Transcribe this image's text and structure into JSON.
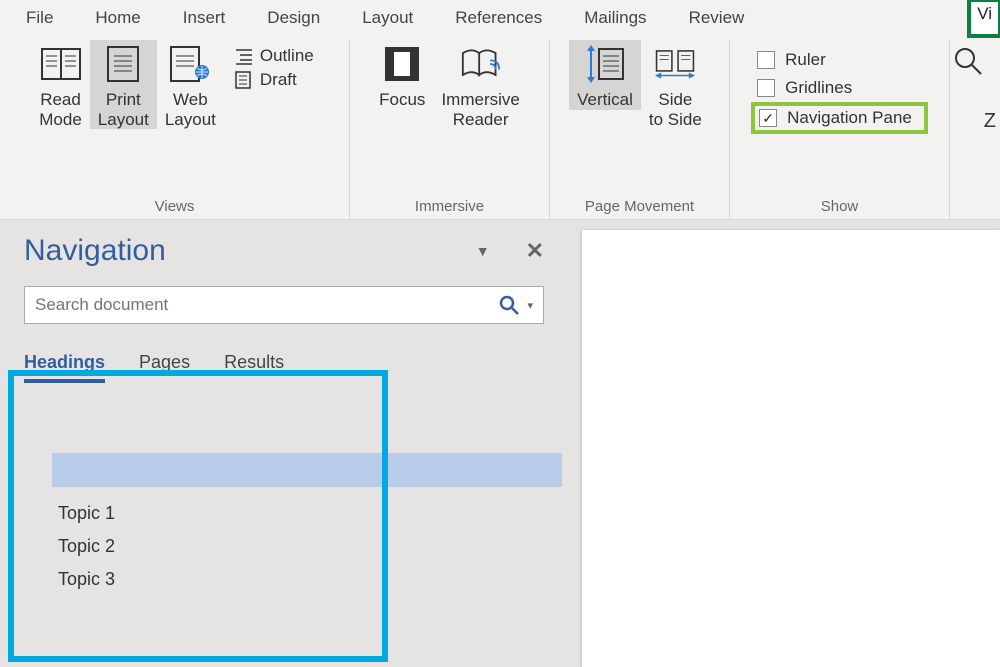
{
  "menu": {
    "file": "File",
    "home": "Home",
    "insert": "Insert",
    "design": "Design",
    "layout": "Layout",
    "references": "References",
    "mailings": "Mailings",
    "review": "Review",
    "view_partial": "Vi"
  },
  "ribbon": {
    "views": {
      "read_mode": "Read\nMode",
      "print_layout": "Print\nLayout",
      "web_layout": "Web\nLayout",
      "outline": "Outline",
      "draft": "Draft",
      "group_label": "Views"
    },
    "immersive": {
      "focus": "Focus",
      "immersive_reader": "Immersive\nReader",
      "group_label": "Immersive"
    },
    "page_movement": {
      "vertical": "Vertical",
      "side_to_side": "Side\nto Side",
      "group_label": "Page Movement"
    },
    "show": {
      "ruler": "Ruler",
      "gridlines": "Gridlines",
      "navigation_pane": "Navigation Pane",
      "group_label": "Show"
    },
    "zoom_partial": "Z"
  },
  "navigation": {
    "title": "Navigation",
    "search_placeholder": "Search document",
    "tabs": {
      "headings": "Headings",
      "pages": "Pages",
      "results": "Results"
    },
    "topics": [
      "Topic 1",
      "Topic 2",
      "Topic 3"
    ]
  }
}
